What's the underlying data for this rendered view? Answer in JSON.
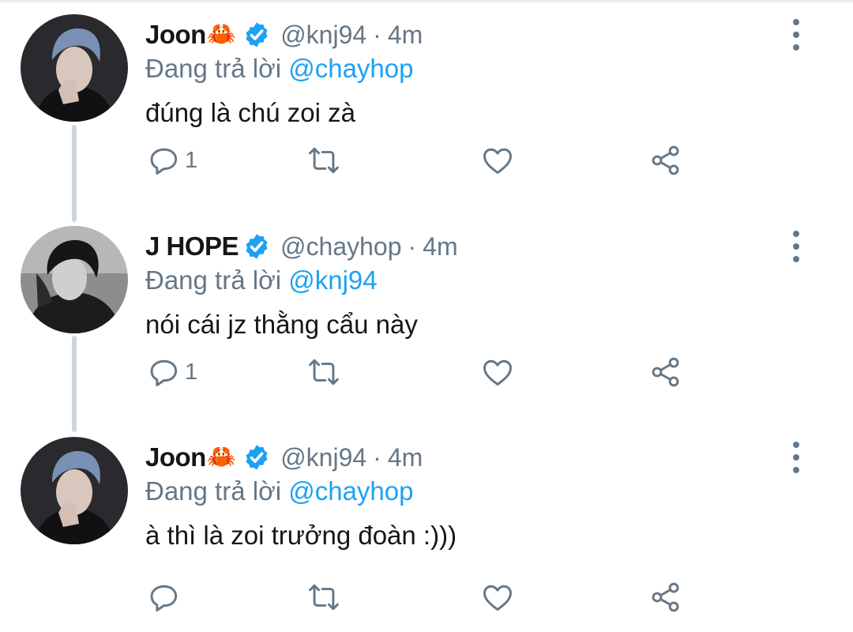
{
  "tweets": [
    {
      "name": "Joon",
      "emoji": "🦀",
      "handle": "@knj94",
      "time": "4m",
      "reply_prefix": "Đang trả lời",
      "reply_mention": "@chayhop",
      "text": "đúng là chú zoi zà",
      "reply_count": "1"
    },
    {
      "name": "J HOPE",
      "emoji": "",
      "handle": "@chayhop",
      "time": "4m",
      "reply_prefix": "Đang trả lời",
      "reply_mention": "@knj94",
      "text": "nói cái jz thằng cẩu này",
      "reply_count": "1"
    },
    {
      "name": "Joon",
      "emoji": "🦀",
      "handle": "@knj94",
      "time": "4m",
      "reply_prefix": "Đang trả lời",
      "reply_mention": "@chayhop",
      "text": "à thì là zoi trưởng đoàn :)))",
      "reply_count": ""
    }
  ],
  "separator": "·",
  "icons": {
    "verified": "verified-badge-icon",
    "reply": "reply-icon",
    "retweet": "retweet-icon",
    "like": "like-heart-icon",
    "share": "share-icon",
    "more": "more-vertical-icon"
  },
  "colors": {
    "accent": "#1da1f2",
    "text": "#14171a",
    "secondary": "#657786",
    "thread_line": "#ccd6dd"
  }
}
